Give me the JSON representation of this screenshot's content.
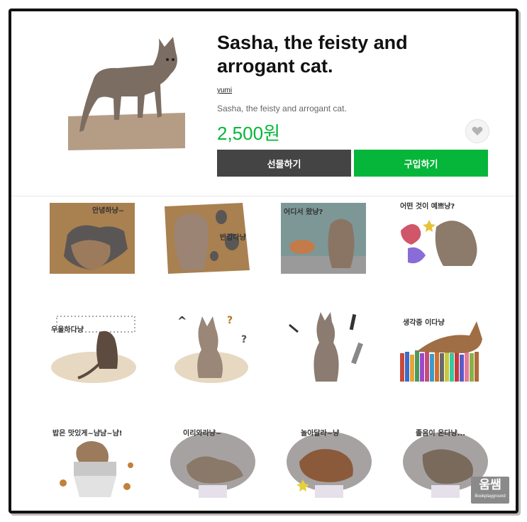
{
  "product": {
    "title": "Sasha, the feisty and arrogant cat.",
    "author": "yumi",
    "description": "Sasha, the feisty and arrogant cat.",
    "price": "2,500원",
    "gift_label": "선물하기",
    "buy_label": "구입하기"
  },
  "stickers": [
    {
      "caption": "안녕하냥~"
    },
    {
      "caption": "반갑다냥"
    },
    {
      "caption": "어디서 왔냥?"
    },
    {
      "caption": "어떤 것이 예쁘냥?"
    },
    {
      "caption": "우울하다냥"
    },
    {
      "caption": ""
    },
    {
      "caption": ""
    },
    {
      "caption": "생각중 이다냥"
    },
    {
      "caption": "밥은 맛있게~냠냠~냠!"
    },
    {
      "caption": "이리와라냥~"
    },
    {
      "caption": "놀아달라~냥"
    },
    {
      "caption": "졸음이 온다냥..."
    }
  ],
  "watermark": {
    "main": "움쌤",
    "sub": "Bookplayground"
  },
  "colors": {
    "accent": "#06b63a",
    "gift_button": "#444444"
  },
  "icons": {
    "favorite": "heart-icon"
  }
}
